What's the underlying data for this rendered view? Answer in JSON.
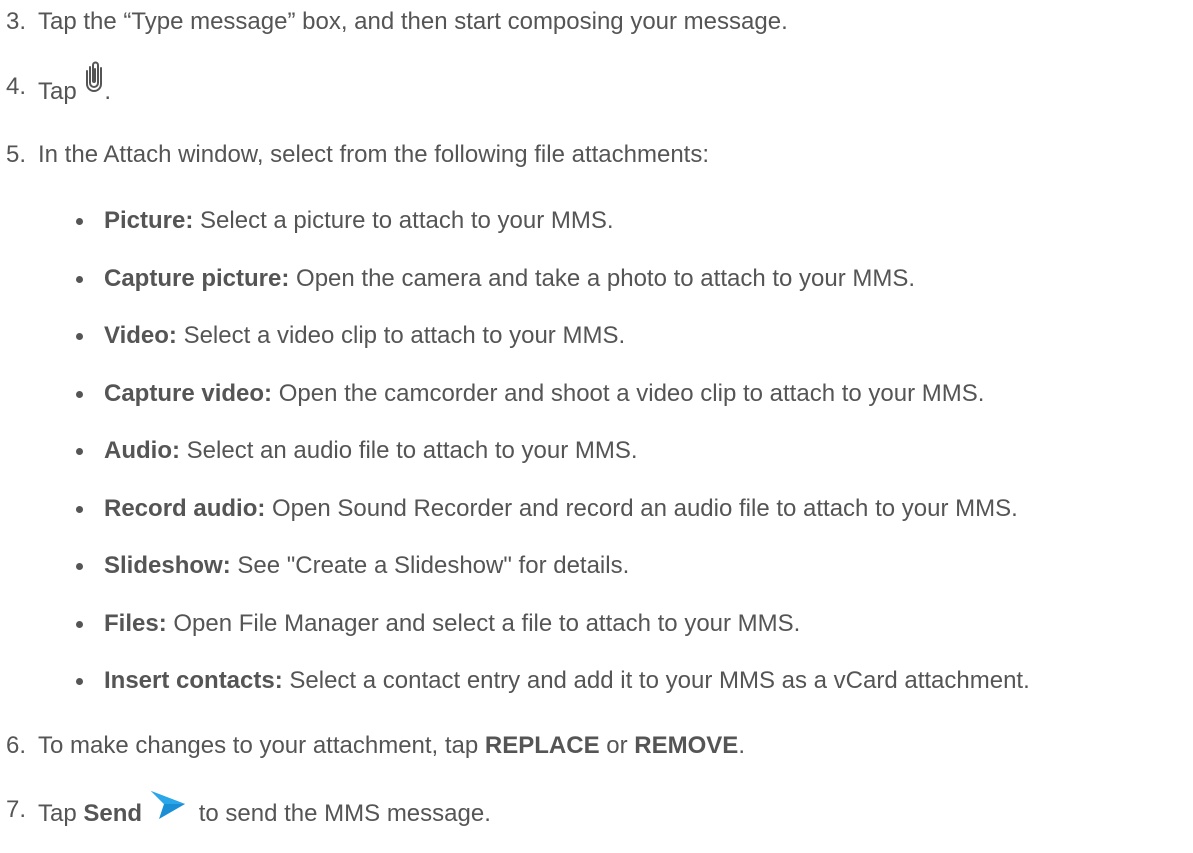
{
  "steps": [
    {
      "number": "3.",
      "text": "Tap the “Type message” box, and then start composing your message."
    },
    {
      "number": "4.",
      "prefix": "Tap",
      "icon": "paperclip-icon",
      "suffix": "."
    },
    {
      "number": "5.",
      "text": "In the Attach window, select from the following file attachments:"
    },
    {
      "number": "6.",
      "prefix": "To make changes to your attachment, tap ",
      "bold1": "REPLACE",
      "middle": " or ",
      "bold2": "REMOVE",
      "suffix": "."
    },
    {
      "number": "7.",
      "prefix": "Tap ",
      "bold": "Send",
      "icon": "send-arrow-icon",
      "suffix": " to send the MMS message."
    }
  ],
  "attachments": [
    {
      "label": "Picture:",
      "desc": " Select a picture to attach to your MMS."
    },
    {
      "label": "Capture picture:",
      "desc": " Open the camera and take a photo to attach to your MMS."
    },
    {
      "label": "Video:",
      "desc": " Select a video clip to attach to your MMS."
    },
    {
      "label": "Capture video:",
      "desc": " Open the camcorder and shoot a video clip to attach to your MMS."
    },
    {
      "label": "Audio:",
      "desc": " Select an audio file to attach to your MMS."
    },
    {
      "label": "Record audio:",
      "desc": " Open Sound Recorder and record an audio file to attach to your MMS."
    },
    {
      "label": "Slideshow:",
      "desc": " See \"Create a Slideshow\" for details."
    },
    {
      "label": "Files:",
      "desc": " Open File Manager and select a file to attach to your MMS."
    },
    {
      "label": "Insert contacts:",
      "desc": " Select a contact entry and add it to your MMS as a vCard attachment."
    }
  ],
  "colors": {
    "text": "#555555",
    "send_icon": "#1a8fd6"
  }
}
